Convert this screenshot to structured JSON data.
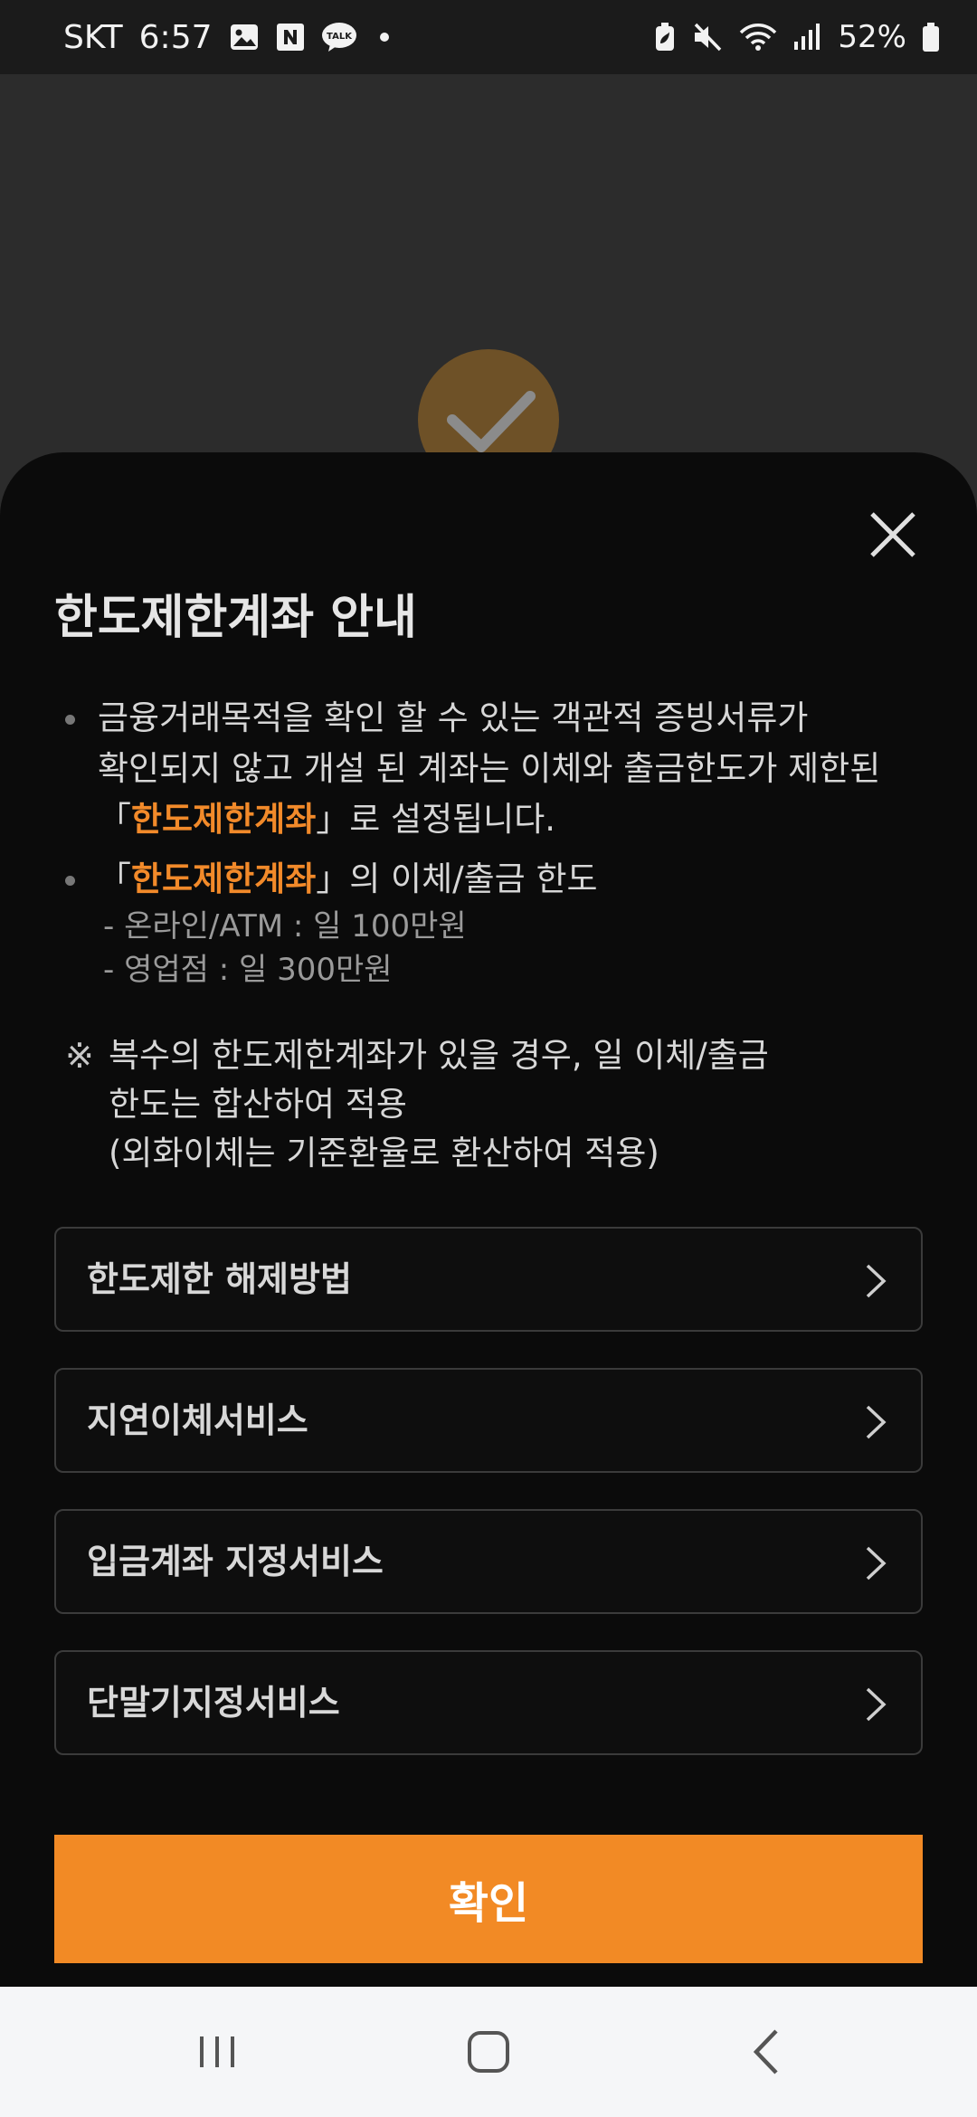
{
  "status_bar": {
    "carrier": "SKT",
    "time": "6:57",
    "battery_percent": "52%"
  },
  "sheet": {
    "title": "한도제한계좌 안내",
    "para1": {
      "line1": "금융거래목적을 확인 할 수 있는 객관적 증빙서류가",
      "line2": "확인되지 않고 개설 된 계좌는 이체와 출금한도가 제한된",
      "line3_open": "「",
      "line3_highlight": "한도제한계좌",
      "line3_rest": "」로 설정됩니다."
    },
    "para2": {
      "open": "「",
      "highlight": "한도제한계좌",
      "rest": "」의 이체/출금 한도",
      "sub1": "-  온라인/ATM :  일 100만원",
      "sub2": "-  영업점 : 일 300만원"
    },
    "note": {
      "mark": "※",
      "line1": "복수의 한도제한계좌가 있을 경우, 일 이체/출금",
      "line2": "한도는 합산하여 적용",
      "line3": "(외화이체는 기준환율로 환산하여 적용)"
    },
    "menu": [
      {
        "label": "한도제한 해제방법"
      },
      {
        "label": "지연이체서비스"
      },
      {
        "label": "입금계좌 지정서비스"
      },
      {
        "label": "단말기지정서비스"
      }
    ],
    "confirm_label": "확인"
  },
  "colors": {
    "accent": "#f28a25",
    "sheet_bg": "#0b0b0b",
    "backdrop": "#2c2c2c"
  },
  "icons": [
    "gallery-icon",
    "naver-icon",
    "kakaotalk-icon",
    "dot-icon",
    "battery-saver-icon",
    "mute-icon",
    "wifi-icon",
    "signal-icon",
    "battery-icon",
    "check-icon",
    "close-icon",
    "chevron-right-icon",
    "recent-apps-icon",
    "home-icon",
    "back-icon"
  ]
}
